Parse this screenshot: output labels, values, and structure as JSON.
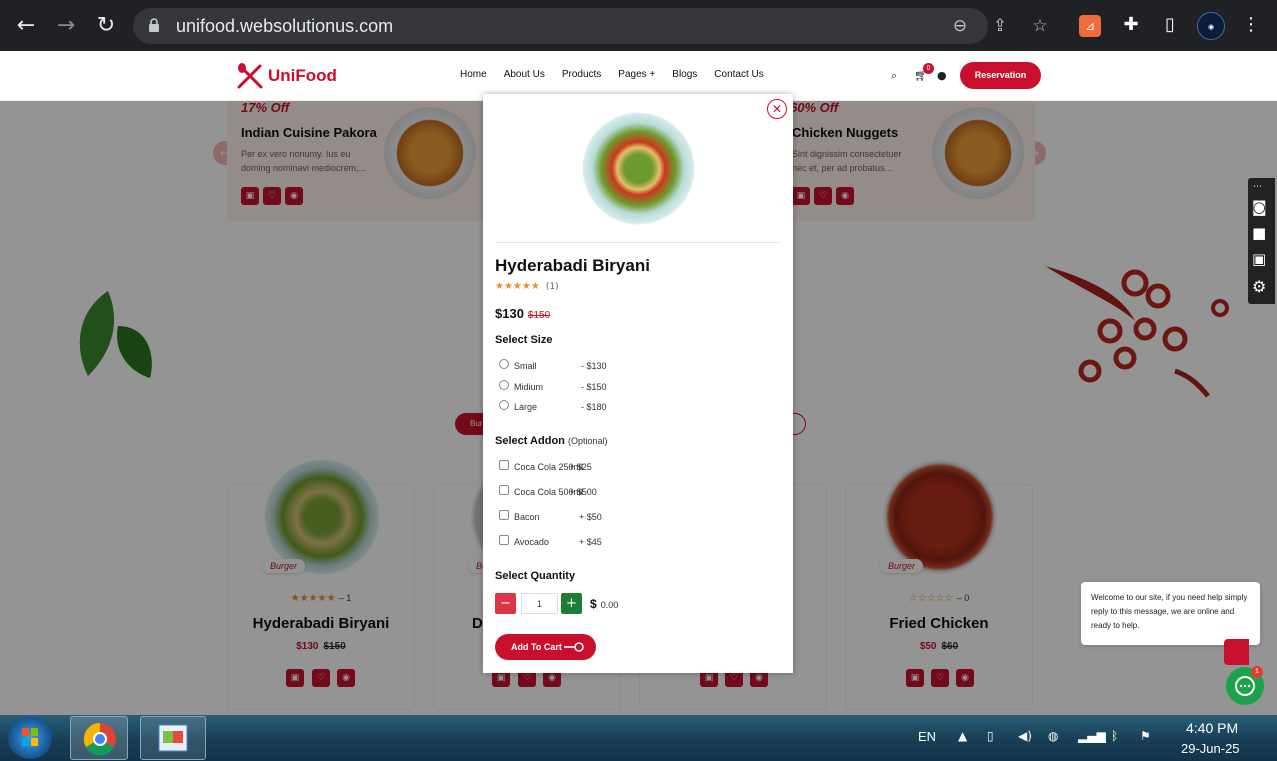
{
  "browser": {
    "url": "unifood.websolutionus.com",
    "icons": [
      "back-icon",
      "forward-icon",
      "reload-icon",
      "lock-icon",
      "zoom-icon",
      "share-icon",
      "star-icon",
      "extension-icon",
      "puzzle-icon",
      "sidepanel-icon",
      "profile-icon",
      "menu-icon"
    ]
  },
  "site": {
    "logo_text": "UniFood",
    "nav": [
      "Home",
      "About Us",
      "Products",
      "Pages +",
      "Blogs",
      "Contact Us"
    ],
    "cart_count": "0",
    "reservation_label": "Reservation"
  },
  "offers": [
    {
      "percent": "17% Off",
      "title": "Indian Cuisine Pakora",
      "desc_line1": "Per ex vero nonumy. Ius eu",
      "desc_line2": "doming nominavi mediocrem,..."
    },
    {
      "percent": "60% Off",
      "title": "Chicken Nuggets",
      "desc_line1": "Sint dignissim consectetuer",
      "desc_line2": "nec et, per ad probatus..."
    }
  ],
  "cards": [
    {
      "badge": "Burger",
      "rating_text": "– 1",
      "name": "Hyderabadi Biryani",
      "price": "$130",
      "old_price": "$150"
    },
    {
      "badge": "Burger",
      "rating_text": "",
      "name": "D",
      "price": "",
      "old_price": ""
    },
    {
      "badge": "",
      "rating_text": "",
      "name": "",
      "price": "",
      "old_price": ""
    },
    {
      "badge": "Burger",
      "rating_text": "– 0",
      "name": "Fried Chicken",
      "price": "$50",
      "old_price": "$60"
    }
  ],
  "partial_tab": "Bur",
  "modal": {
    "title": "Hyderabadi Biryani",
    "stars": "★★★★★",
    "rating_count": "(1)",
    "price": "$130",
    "old_price": "$150",
    "size_heading": "Select Size",
    "sizes": [
      {
        "label": "Small",
        "price": "- $130"
      },
      {
        "label": "Midium",
        "price": "- $150"
      },
      {
        "label": "Large",
        "price": "- $180"
      }
    ],
    "addon_heading": "Select Addon",
    "addon_optional": "(Optional)",
    "addons": [
      {
        "label": "Coca Cola 250ml",
        "price": "+ $25"
      },
      {
        "label": "Coca Cola 500ml",
        "price": "+ $500"
      },
      {
        "label": "Bacon",
        "price": "+ $50"
      },
      {
        "label": "Avocado",
        "price": "+ $45"
      }
    ],
    "quantity_heading": "Select Quantity",
    "quantity_value": "1",
    "total_currency": "$",
    "total_value": "0.00",
    "add_to_cart_label": "Add To Cart"
  },
  "chat": {
    "message": "Welcome to our site, if you need help simply reply to this message, we are online and ready to help.",
    "badge": "1"
  },
  "taskbar": {
    "language": "EN",
    "time": "4:40 PM",
    "date": "29-Jun-25"
  },
  "colors": {
    "brand": "#c8102e",
    "star": "#f08c2c",
    "plus_green": "#1e7e34"
  }
}
